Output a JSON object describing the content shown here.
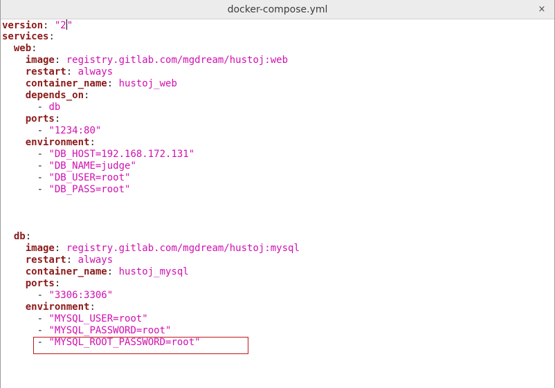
{
  "window": {
    "title": "docker-compose.yml",
    "close_glyph": "×"
  },
  "lines": [
    {
      "indent": "",
      "key": "version",
      "sep": ": ",
      "value": "\"2\"",
      "caret_after": 2
    },
    {
      "indent": "",
      "key": "services",
      "sep": ":",
      "value": ""
    },
    {
      "indent": "  ",
      "key": "web",
      "sep": ":",
      "value": ""
    },
    {
      "indent": "    ",
      "key": "image",
      "sep": ": ",
      "value": "registry.gitlab.com/mgdream/hustoj:web"
    },
    {
      "indent": "    ",
      "key": "restart",
      "sep": ": ",
      "value": "always"
    },
    {
      "indent": "    ",
      "key": "container_name",
      "sep": ": ",
      "value": "hustoj_web"
    },
    {
      "indent": "    ",
      "key": "depends_on",
      "sep": ":",
      "value": ""
    },
    {
      "indent": "      ",
      "dash": "- ",
      "value": "db"
    },
    {
      "indent": "    ",
      "key": "ports",
      "sep": ":",
      "value": ""
    },
    {
      "indent": "      ",
      "dash": "- ",
      "value": "\"1234:80\""
    },
    {
      "indent": "    ",
      "key": "environment",
      "sep": ":",
      "value": ""
    },
    {
      "indent": "      ",
      "dash": "- ",
      "value": "\"DB_HOST=192.168.172.131\""
    },
    {
      "indent": "      ",
      "dash": "- ",
      "value": "\"DB_NAME=judge\""
    },
    {
      "indent": "      ",
      "dash": "- ",
      "value": "\"DB_USER=root\""
    },
    {
      "indent": "      ",
      "dash": "- ",
      "value": "\"DB_PASS=root\""
    },
    {
      "indent": "",
      "value": ""
    },
    {
      "indent": "",
      "value": ""
    },
    {
      "indent": "",
      "value": ""
    },
    {
      "indent": "  ",
      "key": "db",
      "sep": ":",
      "value": ""
    },
    {
      "indent": "    ",
      "key": "image",
      "sep": ": ",
      "value": "registry.gitlab.com/mgdream/hustoj:mysql"
    },
    {
      "indent": "    ",
      "key": "restart",
      "sep": ": ",
      "value": "always"
    },
    {
      "indent": "    ",
      "key": "container_name",
      "sep": ": ",
      "value": "hustoj_mysql"
    },
    {
      "indent": "    ",
      "key": "ports",
      "sep": ":",
      "value": ""
    },
    {
      "indent": "      ",
      "dash": "- ",
      "value": "\"3306:3306\""
    },
    {
      "indent": "    ",
      "key": "environment",
      "sep": ":",
      "value": ""
    },
    {
      "indent": "      ",
      "dash": "- ",
      "value": "\"MYSQL_USER=root\""
    },
    {
      "indent": "      ",
      "dash": "- ",
      "value": "\"MYSQL_PASSWORD=root\""
    },
    {
      "indent": "      ",
      "dash": "- ",
      "value": "\"MYSQL_ROOT_PASSWORD=root\""
    }
  ],
  "colors": {
    "key": "#8b1a1a",
    "value": "#d10fb0",
    "highlight_box": "#c0141a"
  }
}
